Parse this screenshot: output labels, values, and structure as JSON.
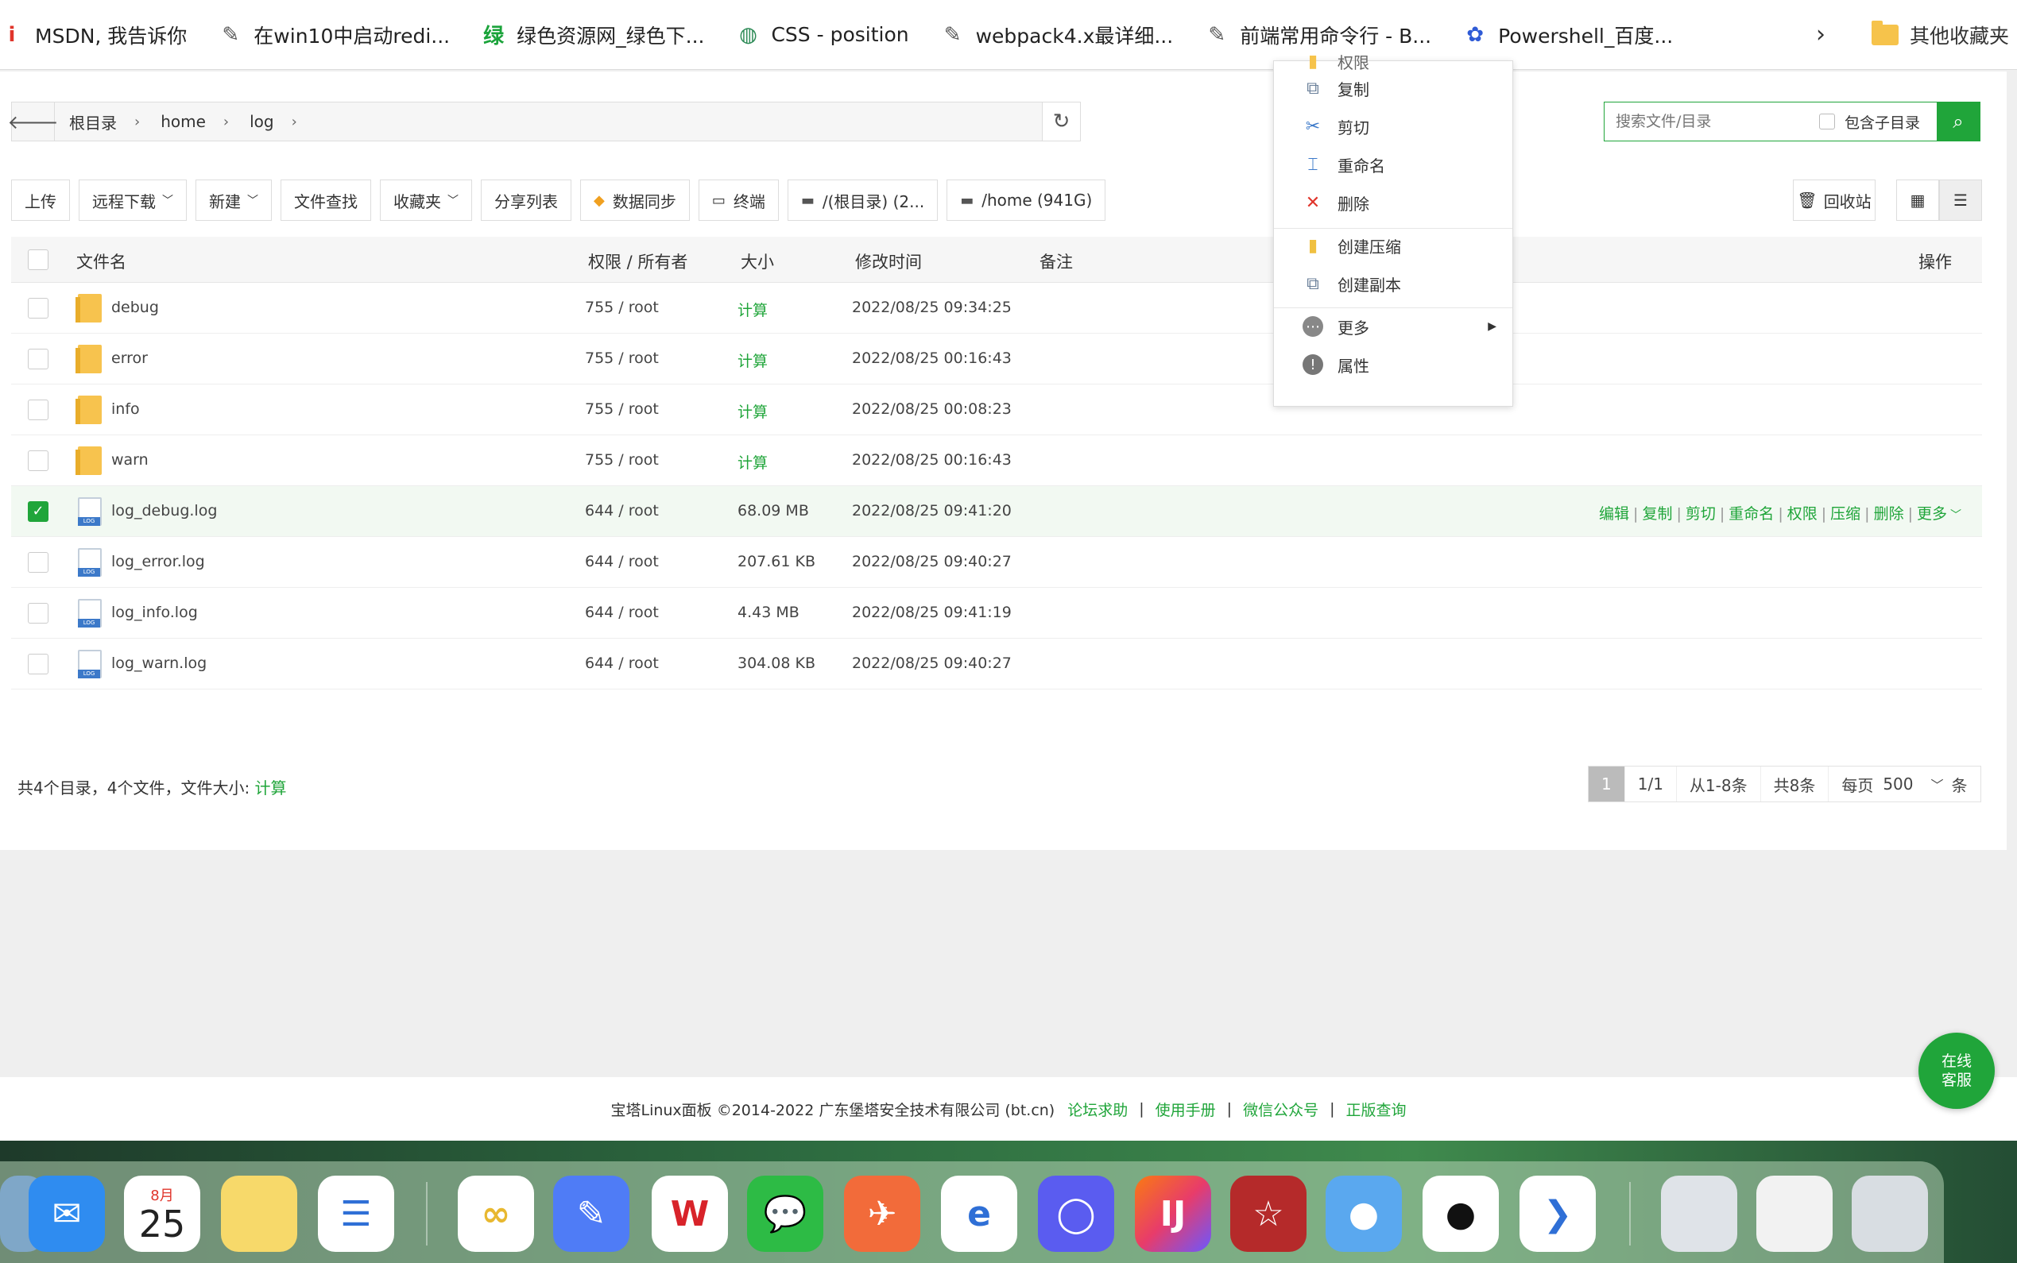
{
  "bookmarks": [
    {
      "label": "MSDN, 我告诉你",
      "icon": "msdn-icon",
      "glyph": "i",
      "color": "#e0352b"
    },
    {
      "label": "在win10中启动redi...",
      "icon": "bookmark-page-icon",
      "glyph": "✎",
      "color": "#555"
    },
    {
      "label": "绿色资源网_绿色下...",
      "icon": "green-resource-icon",
      "glyph": "绿",
      "color": "#1aa33a"
    },
    {
      "label": "CSS - position",
      "icon": "globe-icon",
      "glyph": "◍",
      "color": "#2e8b57"
    },
    {
      "label": "webpack4.x最详细...",
      "icon": "bookmark-page-icon",
      "glyph": "✎",
      "color": "#555"
    },
    {
      "label": "前端常用命令行 - B...",
      "icon": "bookmark-page-icon",
      "glyph": "✎",
      "color": "#555"
    },
    {
      "label": "Powershell_百度...",
      "icon": "baidu-paw-icon",
      "glyph": "✿",
      "color": "#2f5bd6"
    }
  ],
  "bookmarks_more": "›",
  "other_bookmarks": "其他收藏夹",
  "breadcrumb": [
    "根目录",
    "home",
    "log"
  ],
  "search": {
    "placeholder": "搜索文件/目录",
    "include_sub": "包含子目录"
  },
  "toolbar": [
    {
      "label": "上传",
      "caret": false,
      "icon": ""
    },
    {
      "label": "远程下载",
      "caret": true,
      "icon": ""
    },
    {
      "label": "新建",
      "caret": true,
      "icon": ""
    },
    {
      "label": "文件查找",
      "caret": false,
      "icon": ""
    },
    {
      "label": "收藏夹",
      "caret": true,
      "icon": ""
    },
    {
      "label": "分享列表",
      "caret": false,
      "icon": ""
    },
    {
      "label": "数据同步",
      "caret": false,
      "icon": "◆"
    },
    {
      "label": "终端",
      "caret": false,
      "icon": "▭"
    },
    {
      "label": "/(根目录) (2...",
      "caret": false,
      "icon": "▬"
    },
    {
      "label": "/home (941G)",
      "caret": false,
      "icon": "▬"
    }
  ],
  "recycle": "回收站",
  "table": {
    "headers": {
      "name": "文件名",
      "perm": "权限 / 所有者",
      "size": "大小",
      "mtime": "修改时间",
      "note": "备注",
      "ops": "操作"
    },
    "rows": [
      {
        "name": "debug",
        "type": "folder",
        "perm": "755 / root",
        "size": "计算",
        "mtime": "2022/08/25 09:34:25",
        "checked": false
      },
      {
        "name": "error",
        "type": "folder",
        "perm": "755 / root",
        "size": "计算",
        "mtime": "2022/08/25 00:16:43",
        "checked": false
      },
      {
        "name": "info",
        "type": "folder",
        "perm": "755 / root",
        "size": "计算",
        "mtime": "2022/08/25 00:08:23",
        "checked": false
      },
      {
        "name": "warn",
        "type": "folder",
        "perm": "755 / root",
        "size": "计算",
        "mtime": "2022/08/25 00:16:43",
        "checked": false
      },
      {
        "name": "log_debug.log",
        "type": "file",
        "perm": "644 / root",
        "size": "68.09 MB",
        "mtime": "2022/08/25 09:41:20",
        "checked": true
      },
      {
        "name": "log_error.log",
        "type": "file",
        "perm": "644 / root",
        "size": "207.61 KB",
        "mtime": "2022/08/25 09:40:27",
        "checked": false
      },
      {
        "name": "log_info.log",
        "type": "file",
        "perm": "644 / root",
        "size": "4.43 MB",
        "mtime": "2022/08/25 09:41:19",
        "checked": false
      },
      {
        "name": "log_warn.log",
        "type": "file",
        "perm": "644 / root",
        "size": "304.08 KB",
        "mtime": "2022/08/25 09:40:27",
        "checked": false
      }
    ],
    "row_ops": [
      "编辑",
      "复制",
      "剪切",
      "重命名",
      "权限",
      "压缩",
      "删除",
      "更多"
    ]
  },
  "summary": {
    "text": "共4个目录，4个文件，文件大小: ",
    "calc": "计算"
  },
  "pager": {
    "current": "1",
    "pages": "1/1",
    "range": "从1-8条",
    "total": "共8条",
    "per_page_label": "每页",
    "per_page": "500",
    "unit": "条"
  },
  "context_menu": {
    "partial_top": "权限",
    "items": [
      {
        "label": "复制",
        "icon": "copy-icon"
      },
      {
        "label": "剪切",
        "icon": "scissors-icon"
      },
      {
        "label": "重命名",
        "icon": "rename-icon"
      },
      {
        "label": "删除",
        "icon": "delete-x-icon"
      },
      {
        "label": "创建压缩",
        "icon": "archive-icon"
      },
      {
        "label": "创建副本",
        "icon": "duplicate-icon"
      },
      {
        "label": "更多",
        "icon": "more-dots-icon"
      },
      {
        "label": "属性",
        "icon": "info-icon"
      }
    ]
  },
  "footer": {
    "copyright": "宝塔Linux面板 ©2014-2022 广东堡塔安全技术有限公司 (bt.cn)",
    "links": [
      "论坛求助",
      "使用手册",
      "微信公众号",
      "正版查询"
    ]
  },
  "online_service": [
    "在线",
    "客服"
  ],
  "calendar": {
    "month": "8月",
    "day": "25"
  },
  "colors": {
    "accent": "#20a53a",
    "danger": "#e0352b"
  }
}
